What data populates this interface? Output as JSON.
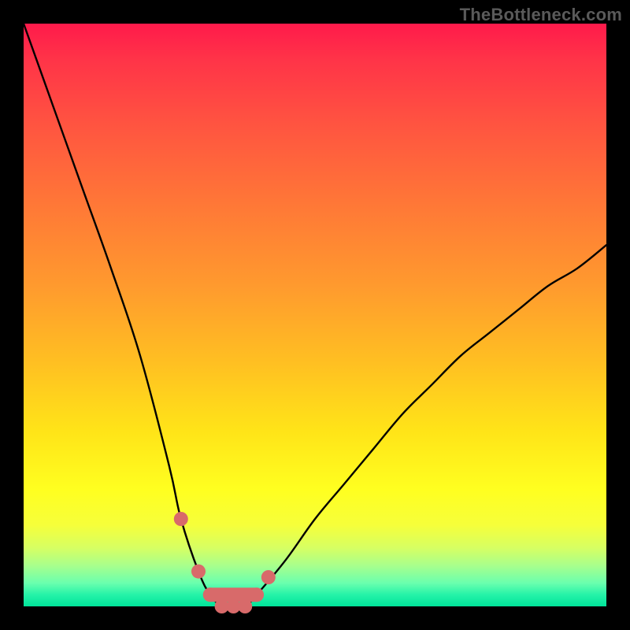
{
  "watermark": "TheBottleneck.com",
  "colors": {
    "background": "#000000",
    "curve_stroke": "#000000",
    "marker": "#d86a6a",
    "gradient_top": "#ff1a4b",
    "gradient_bottom": "#00e39a"
  },
  "chart_data": {
    "type": "line",
    "title": "",
    "xlabel": "",
    "ylabel": "",
    "xlim": [
      0,
      100
    ],
    "ylim": [
      0,
      100
    ],
    "grid": false,
    "legend": false,
    "annotations": [
      {
        "text": "TheBottleneck.com",
        "position": "top-right"
      }
    ],
    "series": [
      {
        "name": "bottleneck-curve",
        "x": [
          0,
          5,
          10,
          15,
          20,
          25,
          27,
          30,
          32,
          34,
          36,
          38,
          40,
          45,
          50,
          55,
          60,
          65,
          70,
          75,
          80,
          85,
          90,
          95,
          100
        ],
        "values": [
          100,
          86,
          72,
          58,
          43,
          24,
          15,
          6,
          2,
          0,
          0,
          0,
          2,
          8,
          15,
          21,
          27,
          33,
          38,
          43,
          47,
          51,
          55,
          58,
          62
        ]
      }
    ],
    "highlight_markers": {
      "name": "near-zero-points",
      "x": [
        27,
        30,
        32,
        34,
        36,
        38,
        40,
        42
      ],
      "values": [
        15,
        6,
        2,
        0,
        0,
        0,
        2,
        5
      ]
    }
  }
}
